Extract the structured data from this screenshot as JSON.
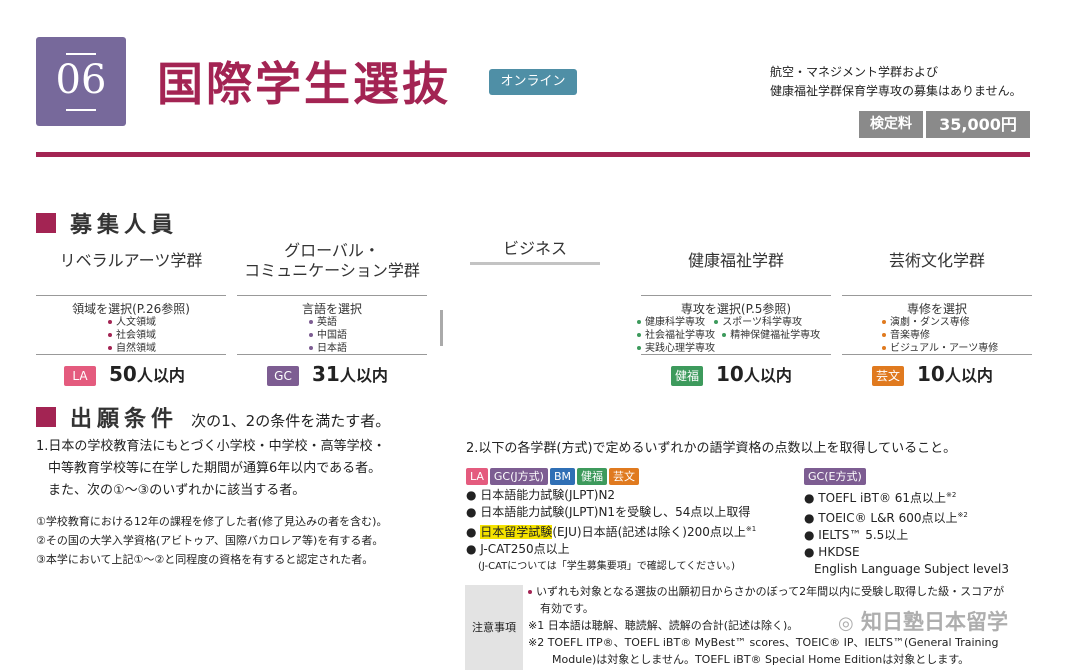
{
  "header": {
    "number": "06",
    "title": "国際学生選抜",
    "online_badge": "オンライン",
    "note_line1": "航空・マネジメント学群および",
    "note_line2": "健康福祉学群保育学専攻の募集はありません。",
    "fee_label": "検定料",
    "fee_value": "35,000円"
  },
  "recruit": {
    "heading": "募集人員",
    "programs": [
      {
        "name": "リベラルアーツ学群",
        "select": "領域を選択(P.26参照)",
        "items": [
          "人文領域",
          "社会領域",
          "自然領域"
        ],
        "tag": "LA",
        "quota_num": "50",
        "quota_unit": "人以内"
      },
      {
        "name_line1": "グローバル・",
        "name_line2": "コミュニケーション学群",
        "select": "言語を選択",
        "items": [
          "英語",
          "中国語",
          "日本語"
        ],
        "tag": "GC",
        "quota_num": "31",
        "quota_unit": "人以内"
      },
      {
        "name_line1": "ビジネス"
      },
      {
        "name": "健康福祉学群",
        "select": "専攻を選択(P.5参照)",
        "items": [
          "健康科学専攻",
          "スポーツ科学専攻",
          "社会福祉学専攻",
          "精神保健福祉学専攻",
          "実践心理学専攻"
        ],
        "tag": "健福",
        "quota_num": "10",
        "quota_unit": "人以内"
      },
      {
        "name": "芸術文化学群",
        "select": "専修を選択",
        "items": [
          "演劇・ダンス専修",
          "音楽専修",
          "ビジュアル・アーツ専修"
        ],
        "tag": "芸文",
        "quota_num": "10",
        "quota_unit": "人以内"
      }
    ]
  },
  "conditions": {
    "heading": "出願条件",
    "heading_sub": "次の1、2の条件を満たす者。",
    "c1_line1": "1.日本の学校教育法にもとづく小学校・中学校・高等学校・",
    "c1_line2": "中等教育学校等に在学した期間が通算6年以内である者。",
    "c1_line3": "また、次の①～③のいずれかに該当する者。",
    "sub1": "①学校教育における12年の課程を修了した者(修了見込みの者を含む)。",
    "sub2": "②その国の大学入学資格(アビトゥア、国際バカロレア等)を有する者。",
    "sub3": "③本学において上記①～②と同程度の資格を有すると認定された者。",
    "c2_title": "2.以下の各学群(方式)で定めるいずれかの語学資格の点数以上を取得していること。",
    "left_tags": [
      "LA",
      "GC(J方式)",
      "BM",
      "健福",
      "芸文"
    ],
    "left_items": [
      "日本語能力試験(JLPT)N2",
      "日本語能力試験(JLPT)N1を受験し、54点以上取得",
      "日本留学試験",
      "(EJU)日本語(記述は除く)200点以上",
      "J-CAT250点以上",
      "(J-CATについては「学生募集要項」で確認してください。)"
    ],
    "right_tag": "GC(E方式)",
    "right_items": [
      "TOEFL iBT® 61点以上",
      "TOEIC® L&R 600点以上",
      "IELTS™ 5.5以上",
      "HKDSE",
      "English Language Subject level3"
    ],
    "notice_label": "注意事項",
    "notice_lines": [
      "いずれも対象となる選抜の出願初日からさかのぼって2年間以内に受験し取得した級・スコアが",
      "有効です。",
      "※1 日本語は聴解、聴読解、読解の合計(記述は除く)。",
      "※2 TOEFL ITP®、TOEFL iBT® MyBest™ scores、TOEIC® IP、IELTS™(General Training",
      "Module)は対象としません。TOEFL iBT® Special Home Editionは対象とします。"
    ]
  },
  "watermark": "知日塾日本留学",
  "colors": {
    "accent": "#a32453",
    "badge": "#77699b",
    "la": "#e45b7e",
    "gc": "#7d5d92",
    "bm": "#2f6fb5",
    "kenpuku": "#3d9a5c",
    "geibun": "#e07a1f",
    "online": "#4f8fa6"
  }
}
